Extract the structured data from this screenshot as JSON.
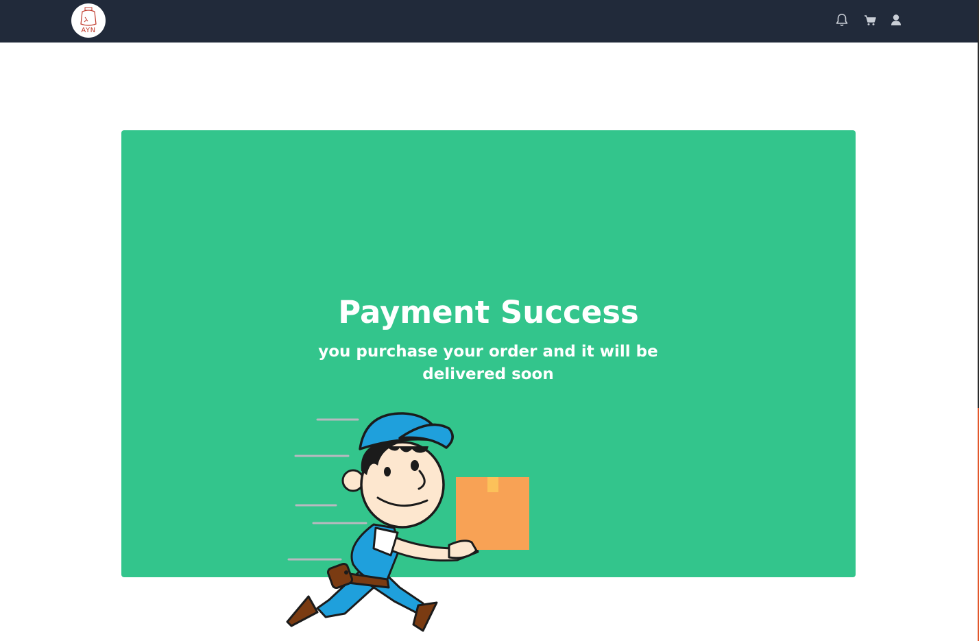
{
  "header": {
    "logo_text": "AYN",
    "icons": [
      "bell-icon",
      "cart-icon",
      "user-icon"
    ]
  },
  "colors": {
    "navbar": "#212a3a",
    "card": "#33c58c",
    "text": "#ffffff",
    "box": "#f8a255",
    "uniform": "#1fa0dc"
  },
  "main": {
    "title": "Payment Success",
    "subtitle": "you purchase your order and it will be delivered soon"
  }
}
